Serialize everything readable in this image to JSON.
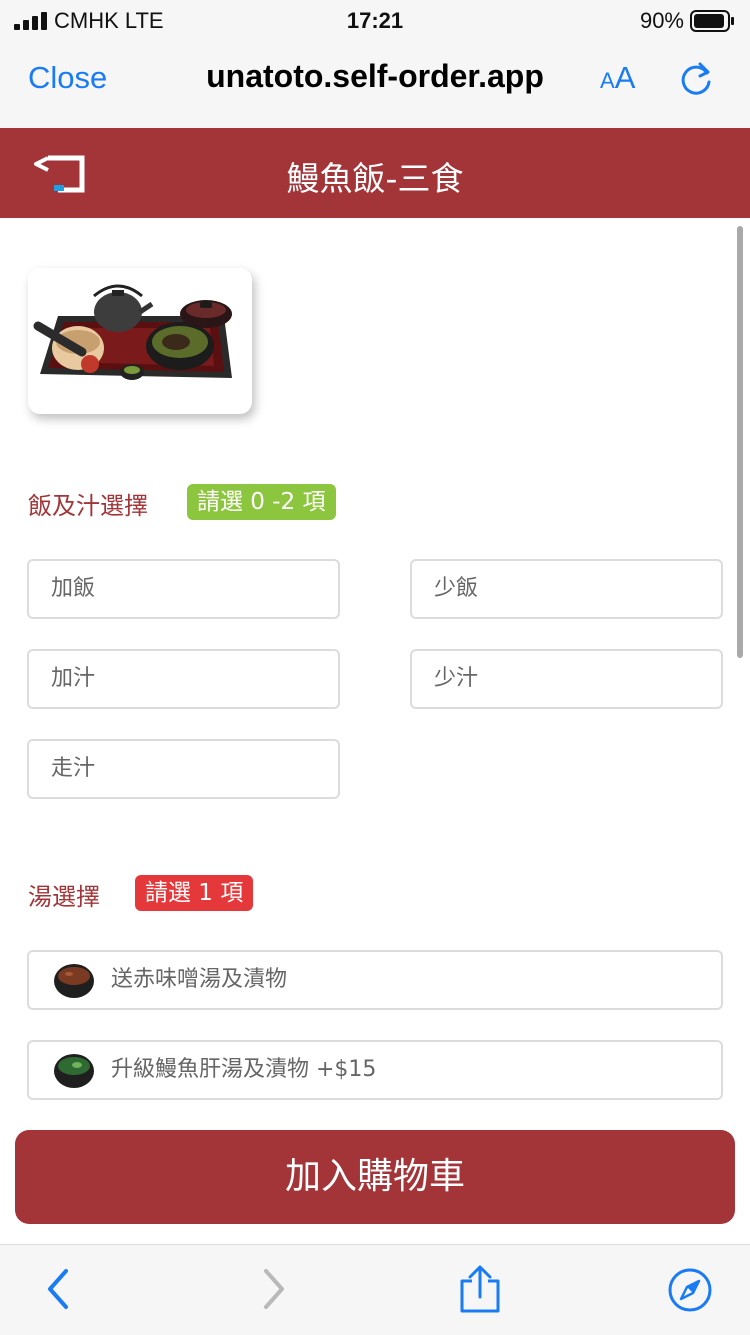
{
  "status": {
    "carrier": "CMHK  LTE",
    "time": "17:21",
    "battery": "90%"
  },
  "browser": {
    "close_label": "Close",
    "url": "unatoto.self-order.app",
    "aa_small": "A",
    "aa_big": "A"
  },
  "header": {
    "title": "鰻魚飯-三食"
  },
  "sections": [
    {
      "title": "飯及汁選擇",
      "badge": "請選 0 -2 項",
      "options": [
        "加飯",
        "少飯",
        "加汁",
        "少汁",
        "走汁"
      ]
    },
    {
      "title": "湯選擇",
      "badge": "請選 1 項",
      "options": [
        "送赤味噌湯及漬物",
        "升級鰻魚肝湯及漬物 +$15"
      ]
    }
  ],
  "cart_button": "加入購物車",
  "colors": {
    "brand": "#a33438",
    "link_blue": "#1a7cf4",
    "badge_green": "#8cc63f",
    "badge_red": "#e5383b"
  },
  "icons": [
    "signal-icon",
    "battery-icon",
    "reload-icon",
    "back-icon",
    "miso-soup-icon",
    "liver-soup-icon",
    "nav-back-icon",
    "nav-forward-icon",
    "share-icon",
    "compass-icon"
  ]
}
